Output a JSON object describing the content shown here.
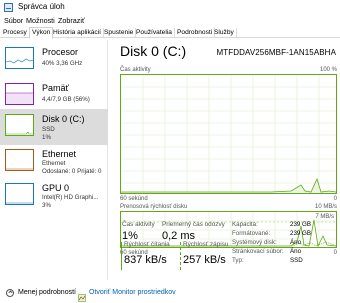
{
  "window": {
    "title": "Správca úloh"
  },
  "menu": [
    "Súbor",
    "Možnosti",
    "Zobraziť"
  ],
  "tabs": [
    "Procesy",
    "Výkon",
    "História aplikácií",
    "Spustenie",
    "Používatelia",
    "Podrobnosti",
    "Služby"
  ],
  "sidebar": [
    {
      "title": "Procesor",
      "lines": [
        "40% 3,36 GHz"
      ],
      "color": "#1779ba"
    },
    {
      "title": "Pamäť",
      "lines": [
        "4,4/7,9 GB (56%)"
      ],
      "color": "#8b1fa9"
    },
    {
      "title": "Disk 0 (C:)",
      "lines": [
        "SSD",
        "1%"
      ],
      "color": "#60a917"
    },
    {
      "title": "Ethernet",
      "lines": [
        "Ethernet",
        "Odoslané: 0 Prijaté: 0"
      ],
      "color": "#a75a17"
    },
    {
      "title": "GPU 0",
      "lines": [
        "Intel(R) HD Graphi...",
        "3%"
      ],
      "color": "#1779ba"
    }
  ],
  "main": {
    "title": "Disk 0 (C:)",
    "model": "MTFDDAV256MBF-1AN15ABHA",
    "activity_graph": {
      "label": "Čas aktivity",
      "max": "100 %",
      "time": "60 sekúnd",
      "min": "0"
    },
    "transfer_graph": {
      "label": "Prenosová rýchlosť disku",
      "max": "10 MB/s",
      "marker": "7 MB/s",
      "time": "60 sekúnd",
      "min": "0"
    },
    "stats": {
      "active_time_label": "Čas aktivity",
      "active_time_value": "1%",
      "avg_response_label": "Priemerný čas odozvy",
      "avg_response_value": "0,2 ms",
      "read_label": "Rýchlosť čítania",
      "read_value": "837 kB/s",
      "write_label": "Rýchlosť zápisu",
      "write_value": "257 kB/s"
    },
    "properties": [
      {
        "label": "Kapacita:",
        "value": "239 GB"
      },
      {
        "label": "Formátované:",
        "value": "239 GB"
      },
      {
        "label": "Systémový disk:",
        "value": "Áno"
      },
      {
        "label": "Stránkovací súbor:",
        "value": "Áno"
      },
      {
        "label": "Typ:",
        "value": "SSD"
      }
    ]
  },
  "footer": {
    "less_details": "Menej podrobností",
    "open_monitor": "Otvoriť Monitor prostriedkov"
  }
}
